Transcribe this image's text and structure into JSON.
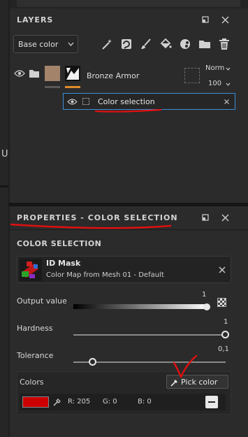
{
  "layers_panel": {
    "title": "LAYERS",
    "channel_select": "Base color",
    "layer": {
      "name": "Bronze Armor",
      "blend_mode": "Norm",
      "opacity": "100"
    },
    "effect": {
      "name": "Color selection"
    },
    "side_letter": "U"
  },
  "properties_panel": {
    "title": "PROPERTIES - COLOR SELECTION",
    "section_title": "COLOR SELECTION",
    "id_mask": {
      "title": "ID Mask",
      "subtitle": "Color Map from Mesh 01 - Default"
    },
    "output_value": {
      "label": "Output value",
      "value": "1"
    },
    "hardness": {
      "label": "Hardness",
      "value": "1",
      "fraction": 1.0
    },
    "tolerance": {
      "label": "Tolerance",
      "value": "0,1",
      "fraction": 0.1
    },
    "colors": {
      "label": "Colors",
      "pick_label": "Pick color",
      "swatch_color": "#cd0000",
      "r": "R: 205",
      "g": "G: 0",
      "b": "B: 0"
    }
  },
  "accent_colors": {
    "selection_border": "#3d8fd6",
    "annotation_red": "#e01010",
    "orange_bar": "#e08a2c"
  }
}
